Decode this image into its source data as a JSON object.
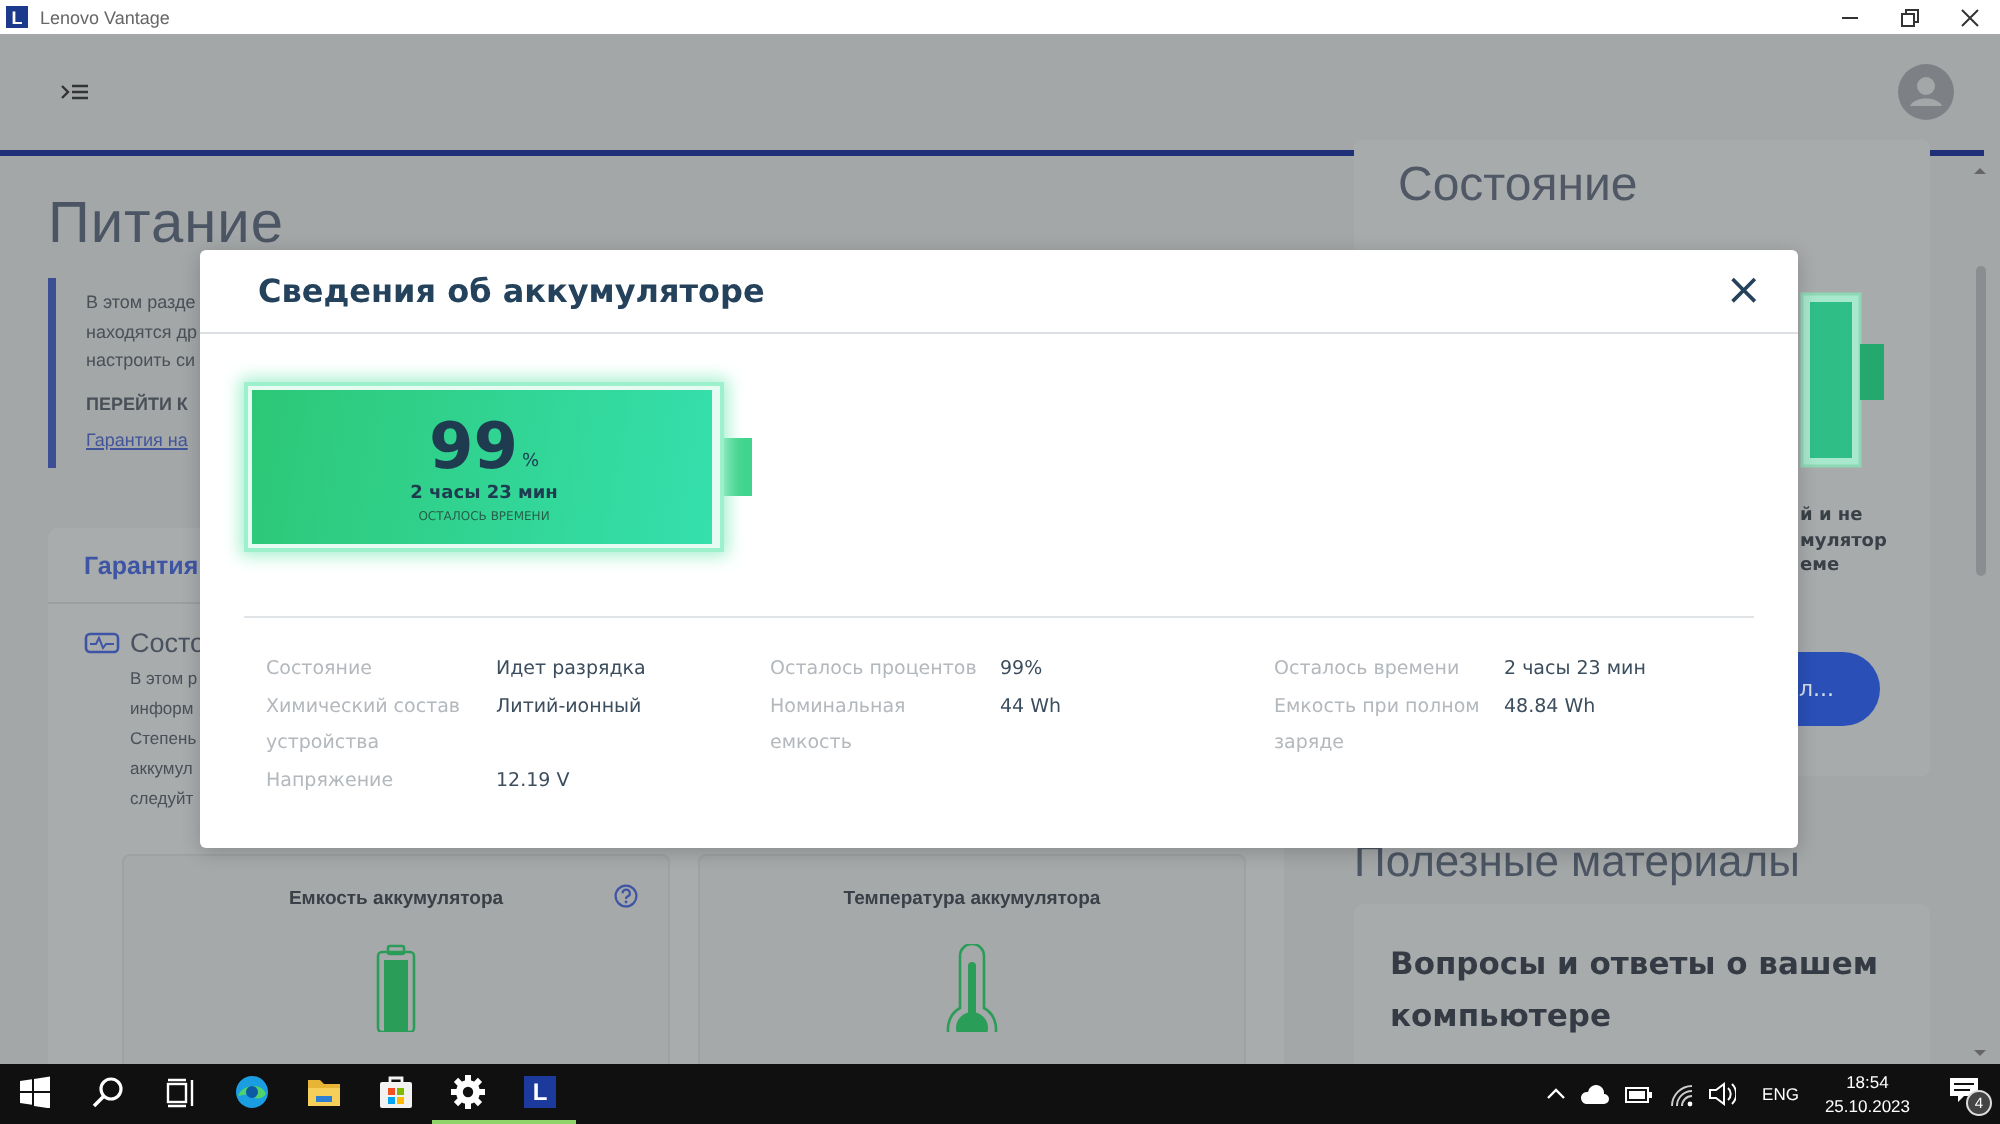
{
  "window": {
    "icon_letter": "L",
    "title": "Lenovo Vantage"
  },
  "page": {
    "title": "Питание",
    "intro_lines": [
      "В этом разде",
      "находятся др",
      "настроить си"
    ],
    "intro_heading": "ПЕРЕЙТИ К",
    "intro_link": "Гарантия на"
  },
  "warranty_card": {
    "title": "Гарантия",
    "section_title": "Состо",
    "section_lines": [
      "В этом р",
      "информ",
      "Степень",
      "аккумул",
      "следуйт"
    ],
    "tiles": [
      {
        "title": "Емкость аккумулятора",
        "help": true,
        "kind": "battery"
      },
      {
        "title": "Температура аккумулятора",
        "help": false,
        "kind": "thermometer"
      }
    ]
  },
  "battery_status_card": {
    "title_lines": [
      "Состояние"
    ],
    "text_lines": [
      "й и не",
      "мулятор",
      "еме"
    ],
    "button": "л..."
  },
  "resources": {
    "title": "Полезные материалы",
    "card_title": "Вопросы и ответы о вашем компьютере"
  },
  "dialog": {
    "title": "Сведения об аккумуляторе",
    "close": "×",
    "battery": {
      "level": 0.99,
      "percent": "99",
      "unit": "%",
      "time": "2 часы 23 мин",
      "caption": "ОСТАЛОСЬ ВРЕМЕНИ"
    },
    "details": [
      [
        {
          "label": "Состояние",
          "value": "Идет разрядка"
        },
        {
          "label": "Химический состав устройства",
          "value": "Литий-ионный"
        },
        {
          "label": "Напряжение",
          "value": "12.19 V"
        }
      ],
      [
        {
          "label": "Осталось процентов",
          "value": "99%"
        },
        {
          "label": "Номинальная емкость",
          "value": "44 Wh"
        }
      ],
      [
        {
          "label": "Осталось времени",
          "value": "2 часы 23 мин"
        },
        {
          "label": "Емкость при полном заряде",
          "value": "48.84 Wh"
        }
      ]
    ]
  },
  "taskbar": {
    "apps": [
      {
        "kind": "edge",
        "active": false
      },
      {
        "kind": "folder",
        "active": false
      },
      {
        "kind": "store",
        "active": false
      },
      {
        "kind": "settings",
        "active": true
      },
      {
        "kind": "lenovo",
        "letter": "L",
        "active": true
      }
    ],
    "language": "ENG",
    "time": "18:54",
    "date": "25.10.2023",
    "notifications": "4"
  }
}
